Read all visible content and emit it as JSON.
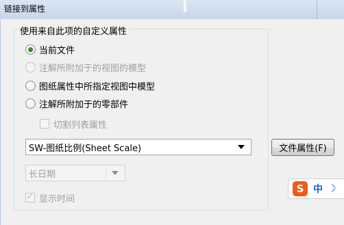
{
  "window": {
    "title": "链接到属性"
  },
  "group": {
    "caption": "使用来自此项的自定义属性",
    "radios": [
      {
        "label": "当前文件",
        "checked": true,
        "disabled": false
      },
      {
        "label": "注解所附加于的视图的模型",
        "checked": false,
        "disabled": true
      },
      {
        "label": "图纸属性中所指定视图中模型",
        "checked": false,
        "disabled": false
      },
      {
        "label": "注解所附加于的零部件",
        "checked": false,
        "disabled": false
      }
    ],
    "cut_list_checkbox": {
      "label": "切割列表属性",
      "checked": false,
      "disabled": true
    },
    "property_combo": {
      "value": "SW-图纸比例(Sheet Scale)"
    },
    "date_combo": {
      "value": "长日期",
      "disabled": true
    },
    "show_time_checkbox": {
      "label": "显示时间",
      "checked": true,
      "disabled": true
    }
  },
  "file_props_button": {
    "label": "文件属性(F)"
  },
  "ime_bar": {
    "logo": "S",
    "mode": "中",
    "moon": "☽"
  }
}
